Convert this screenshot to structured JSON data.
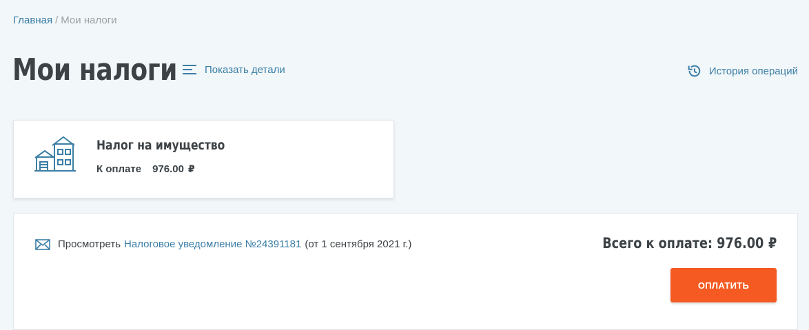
{
  "breadcrumb": {
    "home": "Главная",
    "separator": "/",
    "current": "Мои налоги"
  },
  "page": {
    "title": "Мои налоги",
    "show_details": "Показать детали",
    "history": "История операций"
  },
  "tax_card": {
    "icon": "house-icon",
    "title": "Налог на имущество",
    "due_label": "К оплате",
    "due_amount": "976.00",
    "currency": "₽"
  },
  "summary": {
    "view_text": "Просмотреть",
    "notice_link": "Налоговое уведомление №24391181",
    "notice_date": "(от 1 сентября 2021 г.)",
    "total_label": "Всего к оплате:",
    "total_amount": "976.00",
    "currency": "₽",
    "pay_button": "ОПЛАТИТЬ"
  },
  "colors": {
    "background": "#f2f7f9",
    "link": "#3b7ea6",
    "heading": "#3c4246",
    "accent": "#f45a22",
    "icon": "#3b7ea6"
  }
}
